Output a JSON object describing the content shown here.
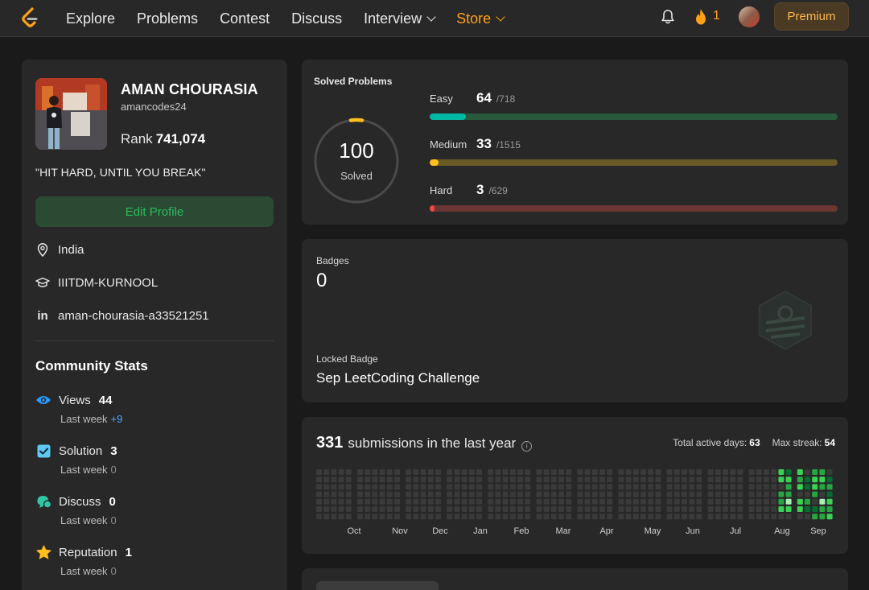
{
  "nav": {
    "items": [
      "Explore",
      "Problems",
      "Contest",
      "Discuss"
    ],
    "interview": "Interview",
    "store": "Store",
    "streak": "1",
    "premium": "Premium"
  },
  "profile": {
    "name": "AMAN CHOURASIA",
    "username": "amancodes24",
    "rank_label": "Rank",
    "rank_value": "741,074",
    "bio": "\"HIT HARD, UNTIL YOU BREAK\"",
    "edit_label": "Edit Profile",
    "location": "India",
    "school": "IIITDM-KURNOOL",
    "linkedin": "aman-chourasia-a33521251"
  },
  "community": {
    "title": "Community Stats",
    "last_week_label": "Last week",
    "stats": [
      {
        "label": "Views",
        "value": "44",
        "delta": "+9"
      },
      {
        "label": "Solution",
        "value": "3",
        "delta": "0"
      },
      {
        "label": "Discuss",
        "value": "0",
        "delta": "0"
      },
      {
        "label": "Reputation",
        "value": "1",
        "delta": "0"
      }
    ]
  },
  "solved": {
    "title": "Solved Problems",
    "total": "100",
    "total_label": "Solved",
    "difficulties": [
      {
        "label": "Easy",
        "count": "64",
        "total": "/718",
        "fraction": 0.089,
        "color": "#00b8a3",
        "track": "#2a5a3e"
      },
      {
        "label": "Medium",
        "count": "33",
        "total": "/1515",
        "fraction": 0.022,
        "color": "#ffc01e",
        "track": "#6a5a26"
      },
      {
        "label": "Hard",
        "count": "3",
        "total": "/629",
        "fraction": 0.005,
        "color": "#ef4743",
        "track": "#6b3532"
      }
    ]
  },
  "badges": {
    "label": "Badges",
    "count": "0",
    "locked_label": "Locked Badge",
    "locked_name": "Sep LeetCoding Challenge"
  },
  "submissions": {
    "count": "331",
    "text": "submissions in the last year",
    "active_days_label": "Total active days:",
    "active_days": "63",
    "max_streak_label": "Max streak:",
    "max_streak": "54",
    "months": [
      "Oct",
      "Nov",
      "Dec",
      "Jan",
      "Feb",
      "Mar",
      "Apr",
      "May",
      "Jun",
      "Jul",
      "Aug",
      "Sep"
    ],
    "colors": {
      "empty": "#3a3a3a",
      "l1": "#0e4429",
      "l2": "#006d32",
      "l3": "#26a641",
      "l4": "#39d353",
      "l5": "#a6f0b4"
    }
  }
}
